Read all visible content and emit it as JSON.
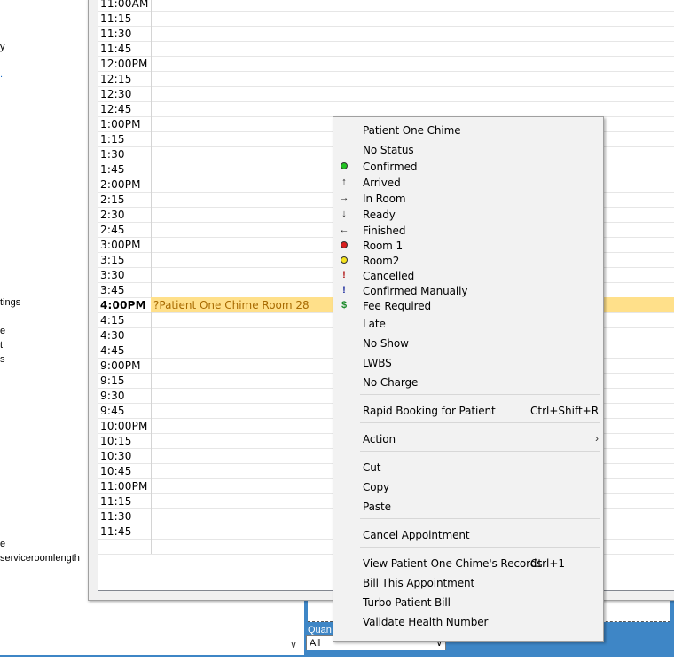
{
  "sidebar_fragments": [
    "y",
    ".",
    "tings",
    "e",
    "t",
    "s",
    "e",
    "serviceroomlength"
  ],
  "schedule": {
    "rows": [
      {
        "time": "11:00AM"
      },
      {
        "time": "11:15"
      },
      {
        "time": "11:30"
      },
      {
        "time": "11:45"
      },
      {
        "time": "12:00PM"
      },
      {
        "time": "12:15"
      },
      {
        "time": "12:30"
      },
      {
        "time": "12:45"
      },
      {
        "time": "1:00PM"
      },
      {
        "time": "1:15"
      },
      {
        "time": "1:30"
      },
      {
        "time": "1:45"
      },
      {
        "time": "2:00PM"
      },
      {
        "time": "2:15"
      },
      {
        "time": "2:30"
      },
      {
        "time": "2:45"
      },
      {
        "time": "3:00PM"
      },
      {
        "time": "3:15"
      },
      {
        "time": "3:30"
      },
      {
        "time": "3:45"
      },
      {
        "time": "4:00PM",
        "appointment": "?Patient One Chime Room 28"
      },
      {
        "time": "4:15"
      },
      {
        "time": "4:30"
      },
      {
        "time": "4:45"
      },
      {
        "time": "9:00PM"
      },
      {
        "time": "9:15"
      },
      {
        "time": "9:30"
      },
      {
        "time": "9:45"
      },
      {
        "time": "10:00PM"
      },
      {
        "time": "10:15"
      },
      {
        "time": "10:30"
      },
      {
        "time": "10:45"
      },
      {
        "time": "11:00PM"
      },
      {
        "time": "11:15"
      },
      {
        "time": "11:30"
      },
      {
        "time": "11:45"
      },
      {
        "time": ""
      }
    ]
  },
  "filter": {
    "label": "Quan",
    "selected": "All"
  },
  "colors": {
    "accent_blue": "#3e86c6",
    "booked_slot": "#ffe08a",
    "menu_bg": "#f2f2f2"
  },
  "context_menu": {
    "items": [
      {
        "label": "Patient One Chime",
        "icon": null
      },
      {
        "label": "No Status",
        "icon": null
      },
      {
        "label": "Confirmed",
        "icon": "green-dot-icon"
      },
      {
        "label": "Arrived",
        "icon": "arrow-up-icon"
      },
      {
        "label": "In Room",
        "icon": "arrow-right-icon"
      },
      {
        "label": "Ready",
        "icon": "arrow-down-icon"
      },
      {
        "label": "Finished",
        "icon": "arrow-left-icon"
      },
      {
        "label": "Room 1",
        "icon": "red-dot-icon"
      },
      {
        "label": "Room2",
        "icon": "yellow-dot-icon"
      },
      {
        "label": "Cancelled",
        "icon": "red-exclamation-icon"
      },
      {
        "label": "Confirmed Manually",
        "icon": "blue-exclamation-icon"
      },
      {
        "label": "Fee Required",
        "icon": "dollar-icon"
      },
      {
        "label": "Late",
        "icon": null
      },
      {
        "label": "No Show",
        "icon": null
      },
      {
        "label": "LWBS",
        "icon": null
      },
      {
        "label": "No Charge",
        "icon": null
      },
      {
        "label": "Rapid Booking for Patient",
        "shortcut": "Ctrl+Shift+R"
      },
      {
        "label": "Action",
        "submenu": true
      },
      {
        "label": "Cut"
      },
      {
        "label": "Copy"
      },
      {
        "label": "Paste"
      },
      {
        "label": "Cancel Appointment"
      },
      {
        "label": "View Patient One Chime's Records",
        "shortcut": "Ctrl+1"
      },
      {
        "label": "Bill This Appointment"
      },
      {
        "label": "Turbo Patient Bill"
      },
      {
        "label": "Validate Health Number"
      }
    ],
    "submenu_arrow": "›"
  }
}
